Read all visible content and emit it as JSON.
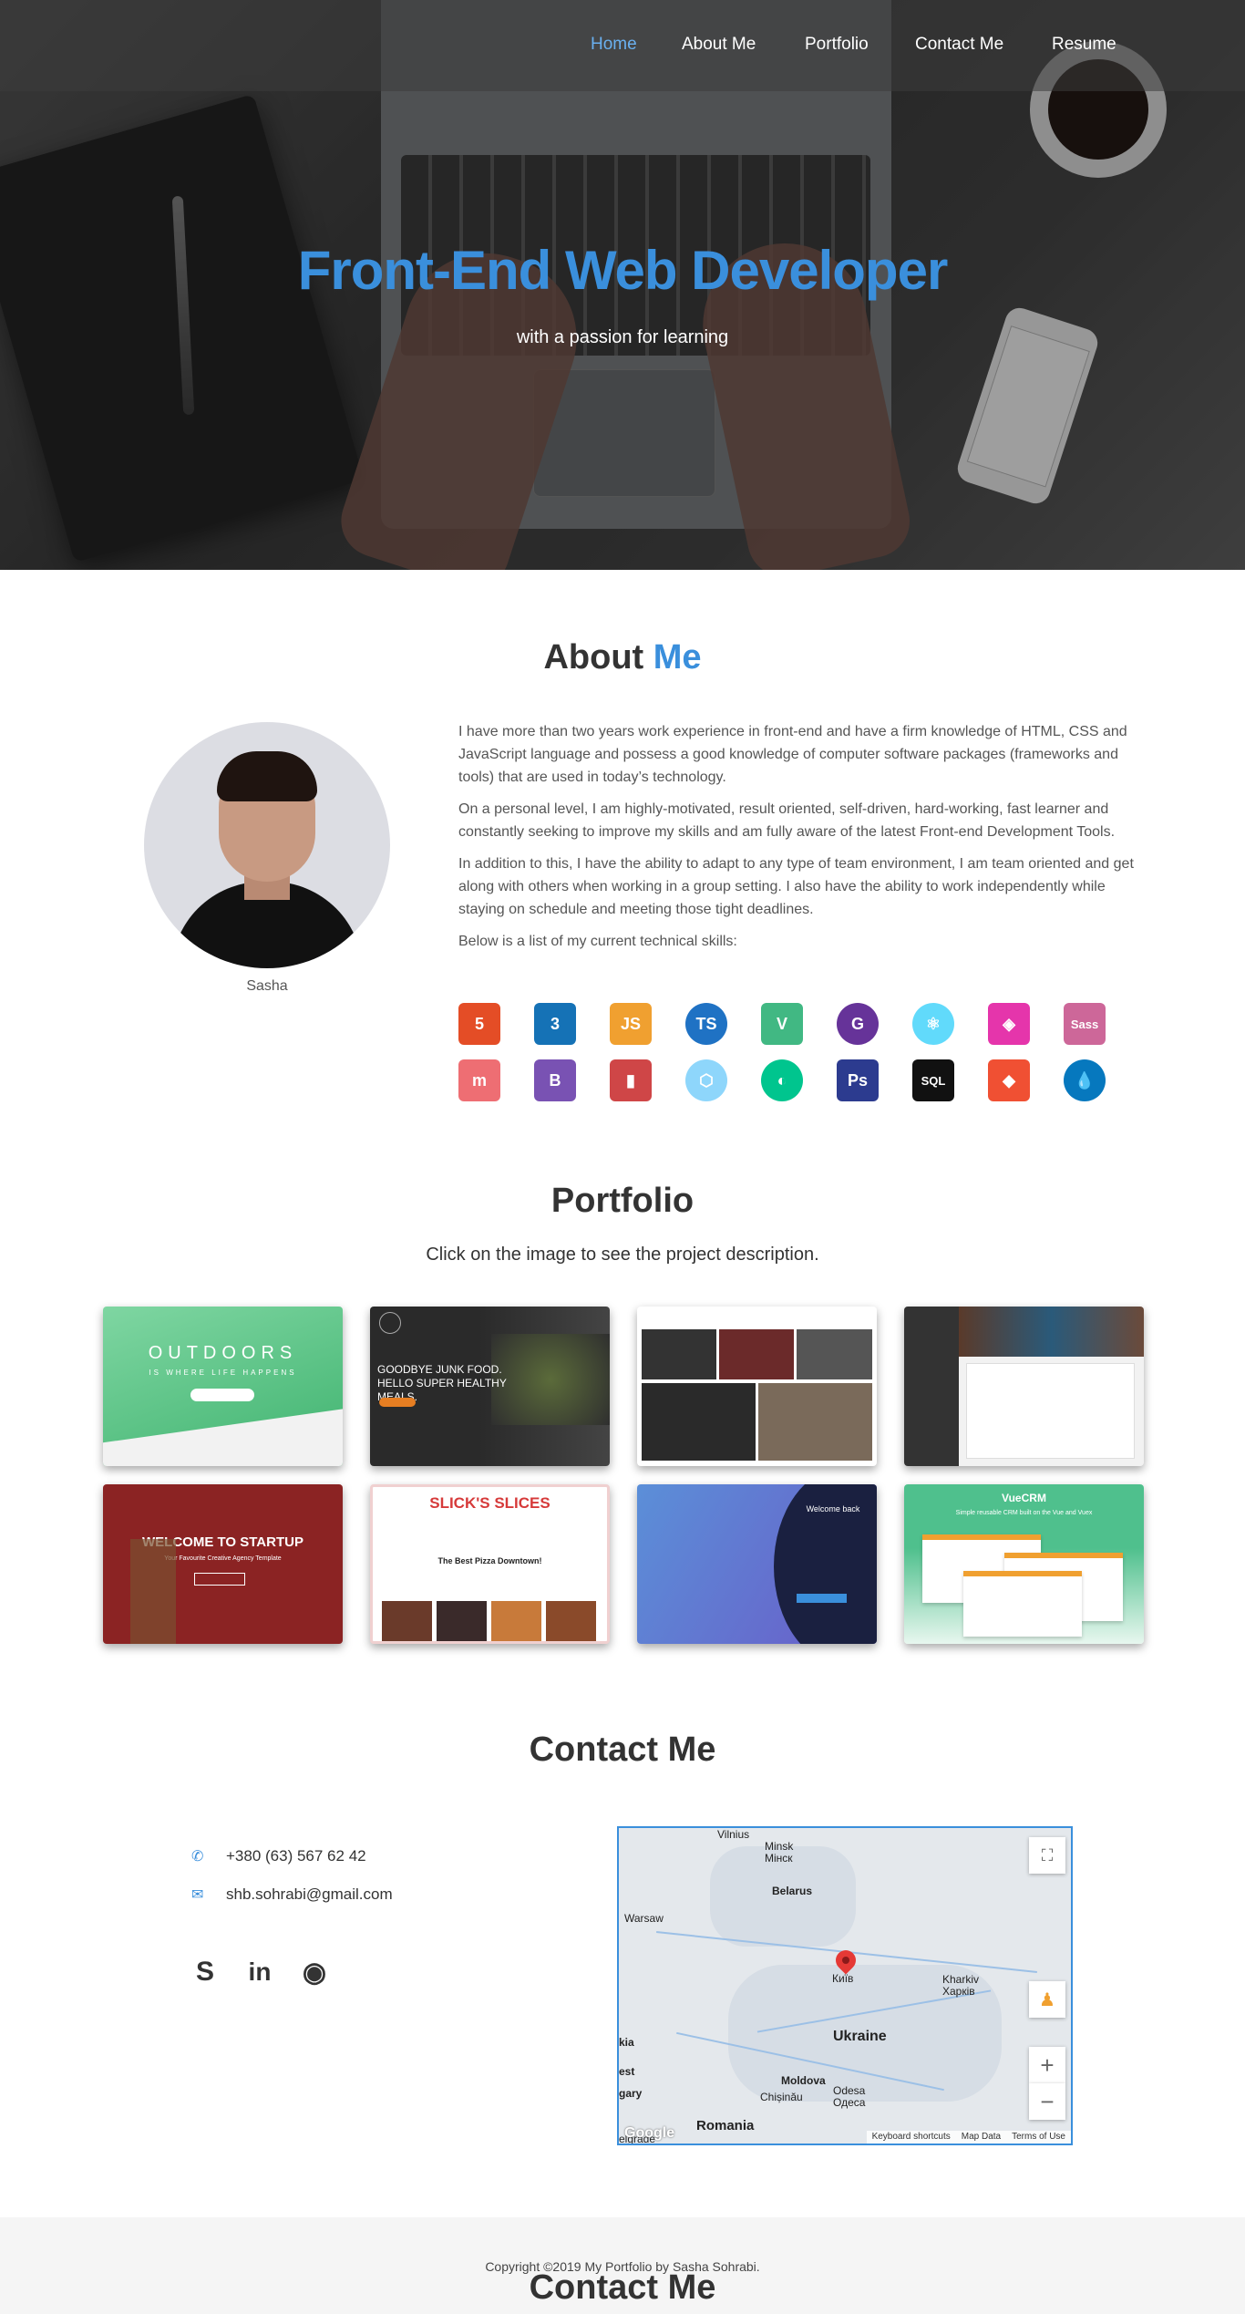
{
  "nav": {
    "items": [
      {
        "label": "Home"
      },
      {
        "label": "About Me"
      },
      {
        "label": "Portfolio"
      },
      {
        "label": "Contact Me"
      },
      {
        "label": "Resume"
      }
    ],
    "active_color": "#6ab0f0"
  },
  "hero": {
    "title": "Front-End Web Developer",
    "subtitle": "with a passion for learning"
  },
  "about": {
    "title_main": "About ",
    "title_accent": "Me",
    "name": "Sasha",
    "paragraphs": [
      "I have more than two years work experience in front-end and have a firm knowledge of HTML, CSS and JavaScript language and possess a good knowledge of computer software packages (frameworks and tools) that are used in today’s technology.",
      "On a personal level, I am highly-motivated, result oriented, self-driven, hard-working, fast learner and constantly seeking to improve my skills and am fully aware of the latest Front-end Development Tools.",
      "In addition to this, I have the ability to adapt to any type of team environment, I am team oriented and get along with others when working in a group setting. I also have the ability to work independently while staying on schedule and meeting those tight deadlines.",
      "Below is a list of my current technical skills:"
    ],
    "skills": [
      {
        "icon": "html5-icon",
        "glyph": "5",
        "color": "#e44d26"
      },
      {
        "icon": "css3-icon",
        "glyph": "3",
        "color": "#1572b6"
      },
      {
        "icon": "javascript-icon",
        "glyph": "JS",
        "color": "#f0a030"
      },
      {
        "icon": "typescript-icon",
        "glyph": "TS",
        "color": "#1f72c4"
      },
      {
        "icon": "vue-icon",
        "glyph": "V",
        "color": "#41b883"
      },
      {
        "icon": "gatsby-icon",
        "glyph": "G",
        "color": "#663399"
      },
      {
        "icon": "react-icon",
        "glyph": "⚛",
        "color": "#61dafb"
      },
      {
        "icon": "graphql-icon",
        "glyph": "◈",
        "color": "#e535ab"
      },
      {
        "icon": "sass-icon",
        "glyph": "Sass",
        "color": "#cd6799"
      },
      {
        "icon": "materialize-icon",
        "glyph": "m",
        "color": "#ee6e73"
      },
      {
        "icon": "bootstrap-icon",
        "glyph": "B",
        "color": "#7952b3"
      },
      {
        "icon": "gulp-icon",
        "glyph": "▮",
        "color": "#cf4647"
      },
      {
        "icon": "webpack-icon",
        "glyph": "⬡",
        "color": "#8ed6fb"
      },
      {
        "icon": "nuxt-icon",
        "glyph": "◐",
        "color": "#00c58e"
      },
      {
        "icon": "photoshop-icon",
        "glyph": "Ps",
        "color": "#2c3b8f"
      },
      {
        "icon": "sql-icon",
        "glyph": "SQL",
        "color": "#111111"
      },
      {
        "icon": "git-icon",
        "glyph": "◆",
        "color": "#f05033"
      },
      {
        "icon": "drupal-icon",
        "glyph": "💧",
        "color": "#0678be"
      }
    ]
  },
  "portfolio": {
    "title": "Portfolio",
    "subtitle": "Click on the image to see the project description.",
    "projects": [
      {
        "caption": "OUTDOORS",
        "tagline": "IS WHERE LIFE HAPPENS"
      },
      {
        "caption": "GOODBYE JUNK FOOD. HELLO SUPER HEALTHY MEALS.",
        "tagline": ""
      },
      {
        "caption": "",
        "tagline": ""
      },
      {
        "caption": "",
        "tagline": ""
      },
      {
        "caption": "WELCOME TO STARTUP",
        "tagline": "Your Favourite Creative Agency Template"
      },
      {
        "caption": "SLICK'S SLICES",
        "tagline": "The Best Pizza Downtown!"
      },
      {
        "caption": "Welcome back",
        "tagline": ""
      },
      {
        "caption": "VueCRM",
        "tagline": "Simple reusable CRM built on the Vue and Vuex"
      }
    ]
  },
  "contact": {
    "title": "Contact Me",
    "phone": "+380 (63) 567 62 42",
    "email": "shb.sohrabi@gmail.com",
    "social": [
      {
        "icon": "skype-icon",
        "glyph": "S"
      },
      {
        "icon": "linkedin-icon",
        "glyph": "in"
      },
      {
        "icon": "github-icon",
        "glyph": "◉"
      }
    ]
  },
  "map": {
    "labels": {
      "vilnius": "Vilnius",
      "minsk": "Minsk\nМінск",
      "belarus": "Belarus",
      "warsaw": "Warsaw",
      "kyiv": "Київ",
      "kharkiv": "Kharkiv\nХарків",
      "ukraine": "Ukraine",
      "moldova": "Moldova",
      "chisinau": "Chișinău",
      "odesa": "Odesa\nОдеса",
      "romania": "Romania",
      "kia": "kia",
      "est": "est",
      "gary": "gary",
      "belgrade": "elgrade"
    },
    "logo": "Google",
    "footer": [
      "Keyboard shortcuts",
      "Map Data",
      "Terms of Use"
    ]
  },
  "footer": {
    "text": "Copyright ©2019 My Portfolio by Sasha Sohrabi."
  }
}
